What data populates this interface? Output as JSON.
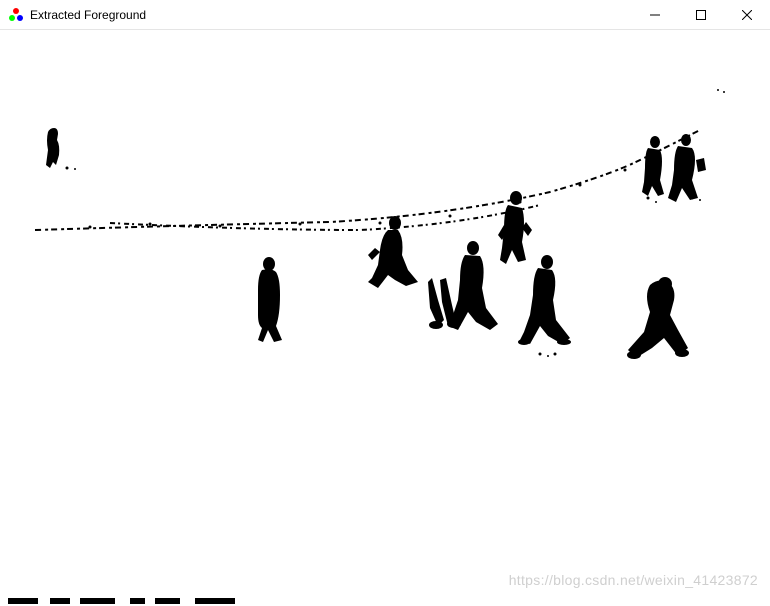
{
  "window": {
    "title": "Extracted Foreground",
    "icon": "opencv-icon"
  },
  "controls": {
    "minimize": "—",
    "maximize": "☐",
    "close": "✕"
  },
  "watermark": "https://blog.csdn.net/weixin_41423872",
  "content": {
    "description": "binary-foreground-extraction-result"
  }
}
